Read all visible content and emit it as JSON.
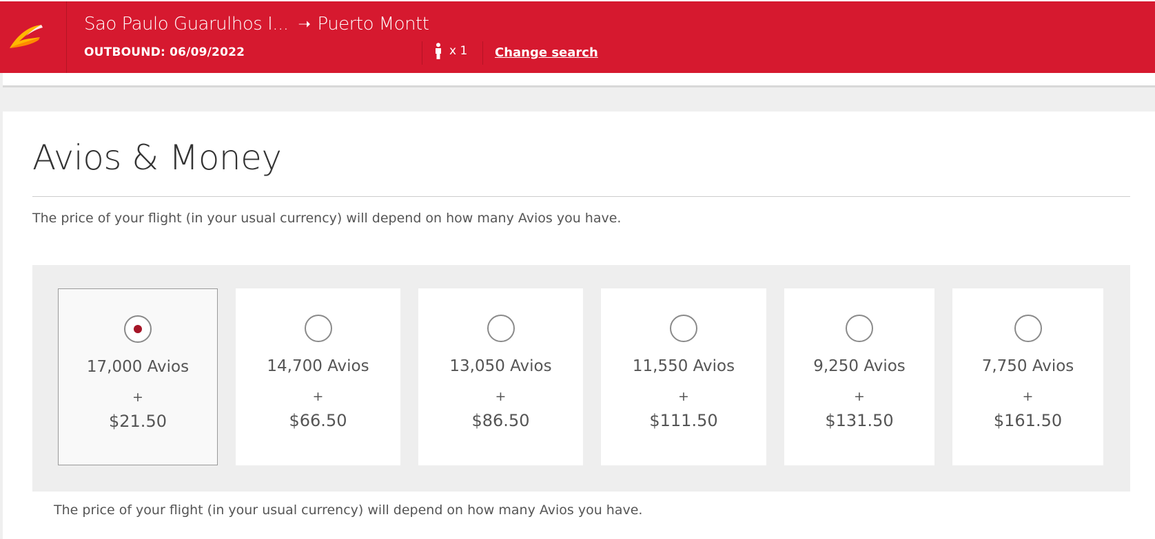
{
  "header": {
    "origin": "Sao Paulo Guarulhos I...",
    "arrow": "➝",
    "destination": "Puerto Montt",
    "outbound": "OUTBOUND: 06/09/2022",
    "passengers": "x 1",
    "change_search": "Change search",
    "brand_color": "#d6192f"
  },
  "main": {
    "title": "Avios & Money",
    "description": "The price of your flight (in your usual currency) will depend on how many Avios you have.",
    "description_bottom": "The price of your flight (in your usual currency) will depend on how many Avios you have.",
    "plus": "+",
    "options": [
      {
        "avios": "17,000 Avios",
        "price": "$21.50",
        "selected": true
      },
      {
        "avios": "14,700 Avios",
        "price": "$66.50",
        "selected": false
      },
      {
        "avios": "13,050 Avios",
        "price": "$86.50",
        "selected": false
      },
      {
        "avios": "11,550 Avios",
        "price": "$111.50",
        "selected": false
      },
      {
        "avios": "9,250 Avios",
        "price": "$131.50",
        "selected": false
      },
      {
        "avios": "7,750 Avios",
        "price": "$161.50",
        "selected": false
      }
    ],
    "selected_color": "#a51527"
  }
}
